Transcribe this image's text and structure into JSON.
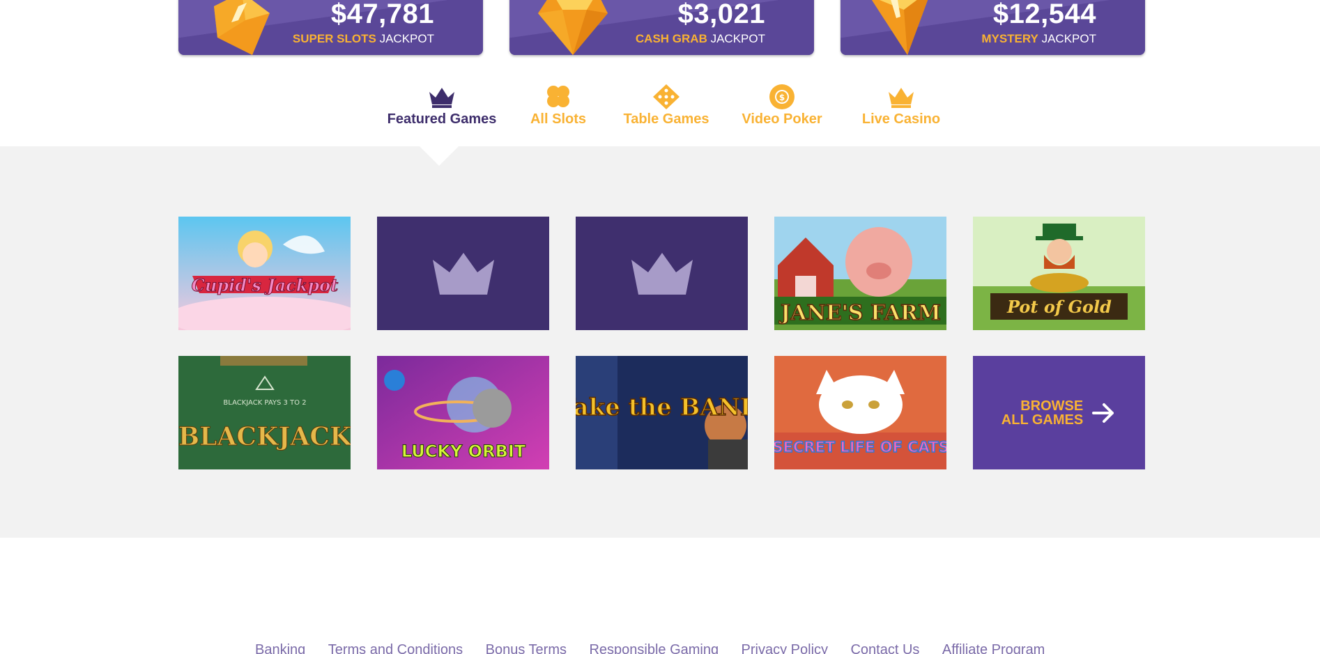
{
  "jackpots": [
    {
      "amount": "$47,781",
      "highlight": "SUPER SLOTS",
      "suffix": "JACKPOT",
      "icon": "gem-icon"
    },
    {
      "amount": "$3,021",
      "highlight": "CASH GRAB",
      "suffix": "JACKPOT",
      "icon": "diamond-icon"
    },
    {
      "amount": "$12,544",
      "highlight": "MYSTERY",
      "suffix": "JACKPOT",
      "icon": "cone-gem-icon"
    }
  ],
  "tabs": [
    {
      "label": "Featured Games",
      "icon": "crown-icon",
      "active": true
    },
    {
      "label": "All Slots",
      "icon": "clover-icon",
      "active": false
    },
    {
      "label": "Table Games",
      "icon": "dice-icon",
      "active": false
    },
    {
      "label": "Video Poker",
      "icon": "chip-icon",
      "active": false
    },
    {
      "label": "Live Casino",
      "icon": "crown-icon",
      "active": false
    }
  ],
  "games": {
    "row1": [
      {
        "title": "Cupid's Jackpot",
        "kind": "thumbnail"
      },
      {
        "title": "",
        "kind": "placeholder"
      },
      {
        "title": "",
        "kind": "placeholder"
      },
      {
        "title": "JANE'S FARM",
        "kind": "thumbnail"
      },
      {
        "title": "Pot of Gold",
        "kind": "thumbnail"
      }
    ],
    "row2": [
      {
        "title": "BLACKJACK",
        "kind": "thumbnail"
      },
      {
        "title": "LUCKY ORBIT",
        "kind": "thumbnail"
      },
      {
        "title": "Take the BANK",
        "kind": "thumbnail"
      },
      {
        "title": "SECRET LIFE OF CATS",
        "kind": "thumbnail"
      }
    ],
    "browse": {
      "line1": "BROWSE",
      "line2": "ALL GAMES"
    }
  },
  "footer_links": [
    "Banking",
    "Terms and Conditions",
    "Bonus Terms",
    "Responsible Gaming",
    "Privacy Policy",
    "Contact Us",
    "Affiliate Program"
  ],
  "colors": {
    "accent": "#f9b233",
    "purple": "#5a3f9e",
    "dark_purple": "#3d2d6b",
    "background": "#f2f2f2"
  }
}
